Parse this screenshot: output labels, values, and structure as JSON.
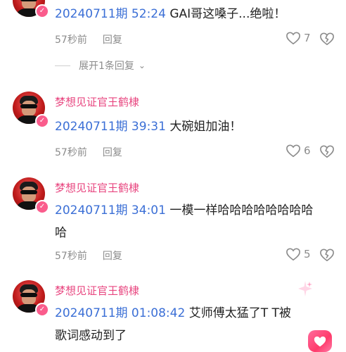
{
  "comments": [
    {
      "username": "",
      "timestamp": "20240711期 52:24",
      "text": " GAI哥这嗓子...绝啦！",
      "time_ago": "57秒前",
      "reply_label": "回复",
      "likes": "7"
    },
    {
      "username": "梦想见证官王鹤棣",
      "timestamp": "20240711期 39:31",
      "text": " 大碗姐加油！",
      "time_ago": "57秒前",
      "reply_label": "回复",
      "likes": "6"
    },
    {
      "username": "梦想见证官王鹤棣",
      "timestamp": "20240711期 34:01",
      "text": " 一模一样哈哈哈哈哈哈哈哈哈",
      "time_ago": "57秒前",
      "reply_label": "回复",
      "likes": "5"
    },
    {
      "username": "梦想见证官王鹤棣",
      "timestamp": "20240711期 01:08:42",
      "text": " 艾师傅太猛了T T被歌词感动到了",
      "time_ago": "",
      "reply_label": "",
      "likes": ""
    }
  ],
  "expand_replies": "展开1条回复",
  "icons": {
    "like": "heart-outline-icon",
    "dislike": "broken-heart-icon",
    "badge": "verified-check-icon",
    "expand": "chevron-down-icon"
  },
  "colors": {
    "username": "#e8457f",
    "timestamp": "#3b6fd6",
    "meta": "#8c8c8c"
  }
}
